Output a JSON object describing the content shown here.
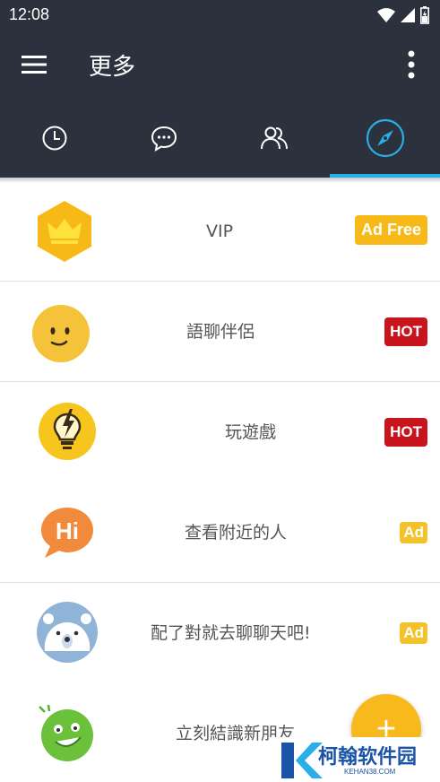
{
  "status_bar": {
    "time": "12:08"
  },
  "app_bar": {
    "title": "更多"
  },
  "tabs": [
    {
      "icon": "clock-icon"
    },
    {
      "icon": "chat-bubble-icon"
    },
    {
      "icon": "people-icon"
    },
    {
      "icon": "compass-icon",
      "selected": true
    }
  ],
  "colors": {
    "header": "#2b323d",
    "accent": "#2aaee8",
    "fab": "#f7b91c",
    "hot": "#c8141c",
    "ad": "#f3c22a"
  },
  "items": [
    {
      "label": "VIP",
      "badge": "Ad Free",
      "icon": "crown-hexagon-icon"
    },
    {
      "label": "語聊伴侶",
      "badge": "HOT",
      "icon": "smiley-face-icon"
    },
    {
      "label": "玩遊戲",
      "badge": "HOT",
      "icon": "lightbulb-bolt-icon"
    },
    {
      "label": "查看附近的人",
      "badge": "Ad",
      "icon": "hi-bubble-icon"
    },
    {
      "label": "配了對就去聊聊天吧!",
      "badge": "Ad",
      "icon": "polar-bear-icon"
    },
    {
      "label": "立刻結識新朋友",
      "badge": "",
      "icon": "green-face-icon"
    }
  ],
  "fab": {
    "label": "+"
  },
  "watermark": {
    "text": "柯翰软件园",
    "sub": "KEHAN38.COM"
  }
}
